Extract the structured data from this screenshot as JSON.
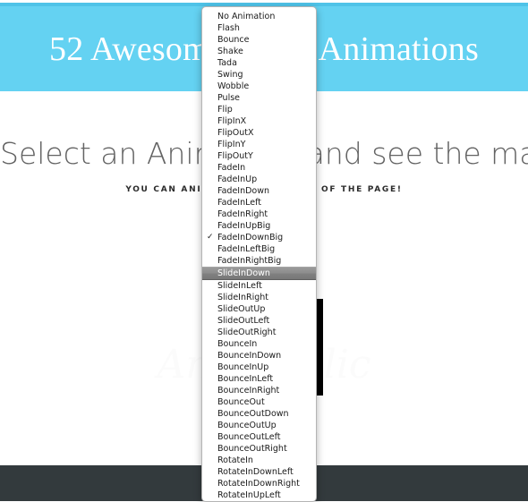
{
  "page": {
    "banner": {
      "title": "52 Awesome CSS3 Animations"
    },
    "hero": {
      "heading": "Select an Animation and see the magic!",
      "subheading": "YOU CAN ANIMATE ANY ELEMENT OF THE PAGE!",
      "watermark": "Animatolic"
    },
    "colors": {
      "banner_bg": "#64d2f2",
      "banner_edge": "#4fc3e8",
      "footer_bg": "#333a3d",
      "heading_text": "#636363",
      "menu_highlight": "#8c8c8c"
    }
  },
  "dropdown": {
    "name": "animation-select-menu",
    "checked_value": "FadeInDownBig",
    "highlighted_value": "SlideInDown",
    "check_glyph": "✓",
    "items": [
      {
        "label": "No Animation",
        "checked": false,
        "highlighted": false
      },
      {
        "label": "Flash",
        "checked": false,
        "highlighted": false
      },
      {
        "label": "Bounce",
        "checked": false,
        "highlighted": false
      },
      {
        "label": "Shake",
        "checked": false,
        "highlighted": false
      },
      {
        "label": "Tada",
        "checked": false,
        "highlighted": false
      },
      {
        "label": "Swing",
        "checked": false,
        "highlighted": false
      },
      {
        "label": "Wobble",
        "checked": false,
        "highlighted": false
      },
      {
        "label": "Pulse",
        "checked": false,
        "highlighted": false
      },
      {
        "label": "Flip",
        "checked": false,
        "highlighted": false
      },
      {
        "label": "FlipInX",
        "checked": false,
        "highlighted": false
      },
      {
        "label": "FlipOutX",
        "checked": false,
        "highlighted": false
      },
      {
        "label": "FlipInY",
        "checked": false,
        "highlighted": false
      },
      {
        "label": "FlipOutY",
        "checked": false,
        "highlighted": false
      },
      {
        "label": "FadeIn",
        "checked": false,
        "highlighted": false
      },
      {
        "label": "FadeInUp",
        "checked": false,
        "highlighted": false
      },
      {
        "label": "FadeInDown",
        "checked": false,
        "highlighted": false
      },
      {
        "label": "FadeInLeft",
        "checked": false,
        "highlighted": false
      },
      {
        "label": "FadeInRight",
        "checked": false,
        "highlighted": false
      },
      {
        "label": "FadeInUpBig",
        "checked": false,
        "highlighted": false
      },
      {
        "label": "FadeInDownBig",
        "checked": true,
        "highlighted": false
      },
      {
        "label": "FadeInLeftBig",
        "checked": false,
        "highlighted": false
      },
      {
        "label": "FadeInRightBig",
        "checked": false,
        "highlighted": false
      },
      {
        "label": "SlideInDown",
        "checked": false,
        "highlighted": true
      },
      {
        "label": "SlideInLeft",
        "checked": false,
        "highlighted": false
      },
      {
        "label": "SlideInRight",
        "checked": false,
        "highlighted": false
      },
      {
        "label": "SlideOutUp",
        "checked": false,
        "highlighted": false
      },
      {
        "label": "SlideOutLeft",
        "checked": false,
        "highlighted": false
      },
      {
        "label": "SlideOutRight",
        "checked": false,
        "highlighted": false
      },
      {
        "label": "BounceIn",
        "checked": false,
        "highlighted": false
      },
      {
        "label": "BounceInDown",
        "checked": false,
        "highlighted": false
      },
      {
        "label": "BounceInUp",
        "checked": false,
        "highlighted": false
      },
      {
        "label": "BounceInLeft",
        "checked": false,
        "highlighted": false
      },
      {
        "label": "BounceInRight",
        "checked": false,
        "highlighted": false
      },
      {
        "label": "BounceOut",
        "checked": false,
        "highlighted": false
      },
      {
        "label": "BounceOutDown",
        "checked": false,
        "highlighted": false
      },
      {
        "label": "BounceOutUp",
        "checked": false,
        "highlighted": false
      },
      {
        "label": "BounceOutLeft",
        "checked": false,
        "highlighted": false
      },
      {
        "label": "BounceOutRight",
        "checked": false,
        "highlighted": false
      },
      {
        "label": "RotateIn",
        "checked": false,
        "highlighted": false
      },
      {
        "label": "RotateInDownLeft",
        "checked": false,
        "highlighted": false
      },
      {
        "label": "RotateInDownRight",
        "checked": false,
        "highlighted": false
      },
      {
        "label": "RotateInUpLeft",
        "checked": false,
        "highlighted": false
      }
    ]
  }
}
